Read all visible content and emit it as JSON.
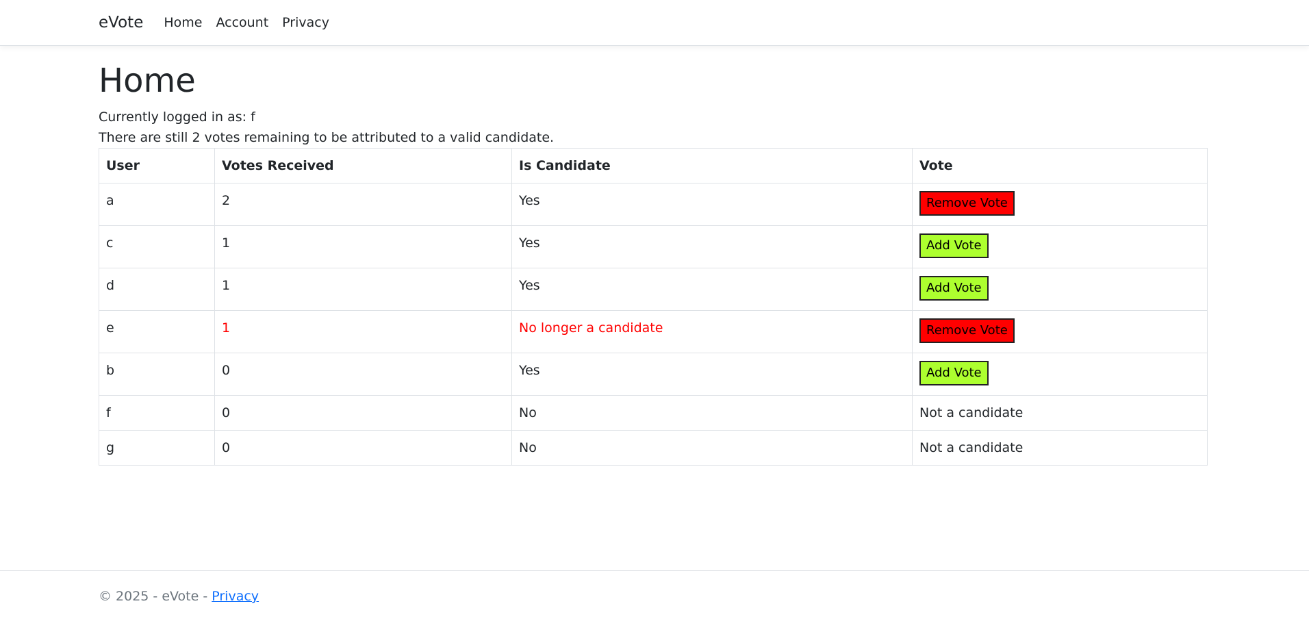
{
  "nav": {
    "brand": "eVote",
    "links": [
      "Home",
      "Account",
      "Privacy"
    ]
  },
  "main": {
    "title": "Home",
    "logged_in_text": "Currently logged in as: f",
    "remaining_text": "There are still 2 votes remaining to be attributed to a valid candidate."
  },
  "table": {
    "headers": [
      "User",
      "Votes Received",
      "Is Candidate",
      "Vote"
    ],
    "rows": [
      {
        "user": "a",
        "votes": "2",
        "candidate": "Yes",
        "vote_label": "Remove Vote"
      },
      {
        "user": "c",
        "votes": "1",
        "candidate": "Yes",
        "vote_label": "Add Vote"
      },
      {
        "user": "d",
        "votes": "1",
        "candidate": "Yes",
        "vote_label": "Add Vote"
      },
      {
        "user": "e",
        "votes": "1",
        "candidate": "No longer a candidate",
        "vote_label": "Remove Vote"
      },
      {
        "user": "b",
        "votes": "0",
        "candidate": "Yes",
        "vote_label": "Add Vote"
      },
      {
        "user": "f",
        "votes": "0",
        "candidate": "No",
        "vote_label": "Not a candidate"
      },
      {
        "user": "g",
        "votes": "0",
        "candidate": "No",
        "vote_label": "Not a candidate"
      }
    ]
  },
  "footer": {
    "text": "© 2025 - eVote - ",
    "link": "Privacy"
  },
  "colors": {
    "remove_button": "#ff0000",
    "add_button": "#adff2f",
    "warning_text": "#ff0000",
    "link": "#0d6efd"
  }
}
